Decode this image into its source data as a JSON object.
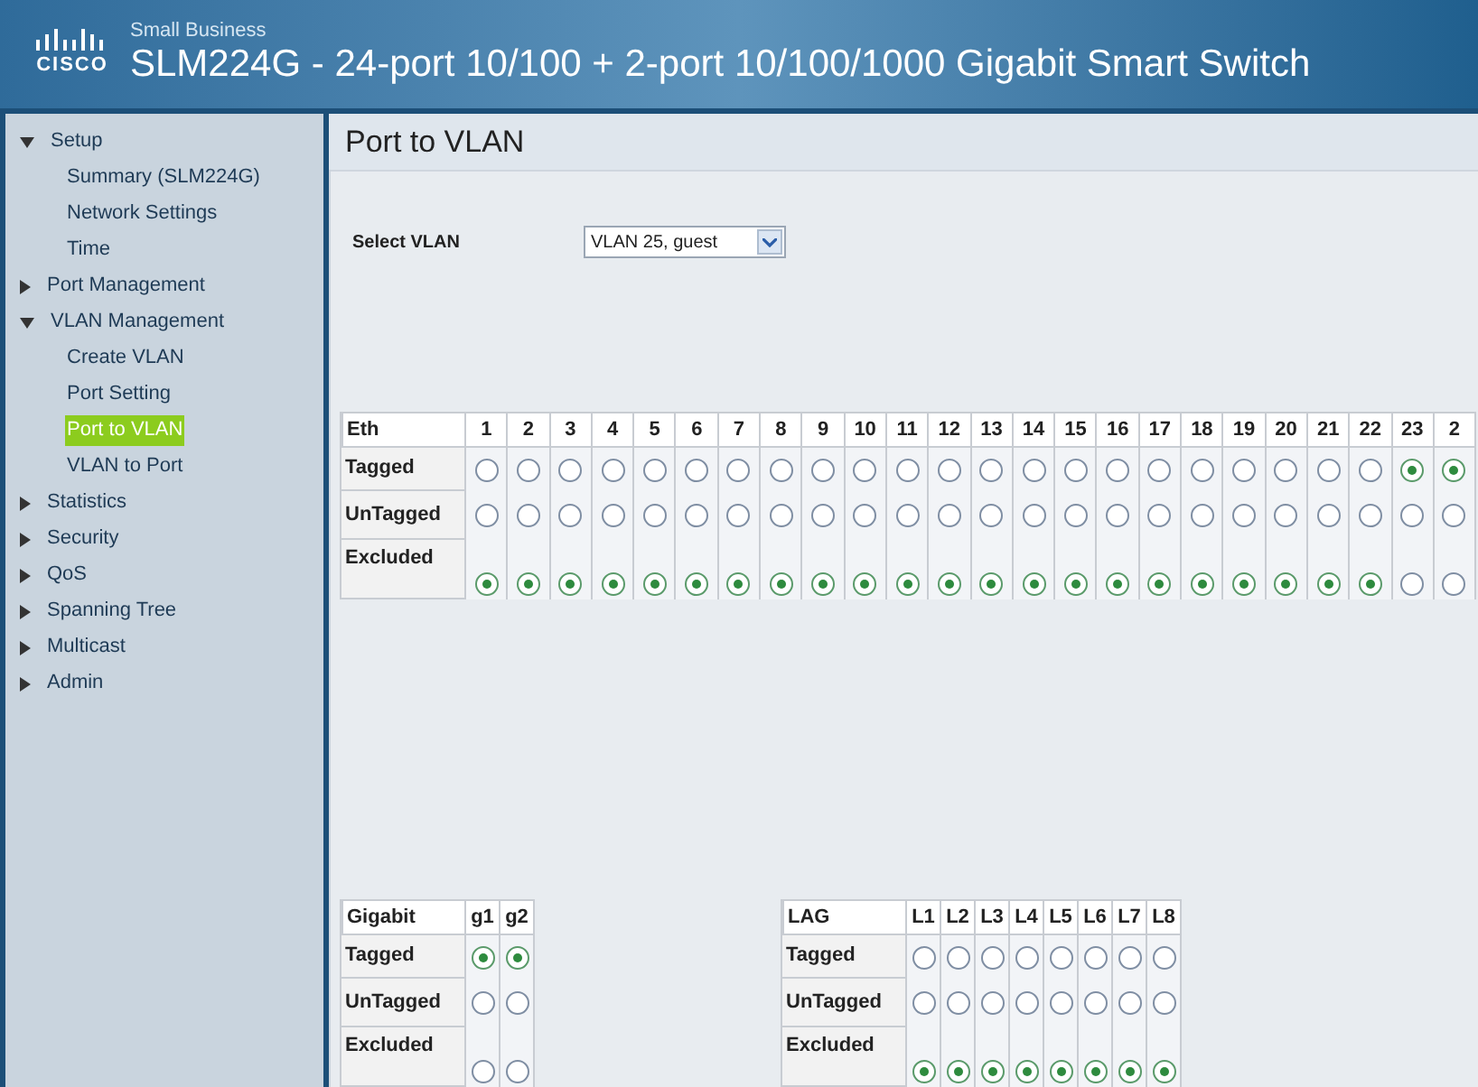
{
  "header": {
    "brand": "CISCO",
    "subtitle": "Small Business",
    "title": "SLM224G - 24-port 10/100 + 2-port 10/100/1000 Gigabit Smart Switch"
  },
  "sidebar": {
    "items": [
      {
        "label": "Setup",
        "expanded": true,
        "selected": false,
        "children": [
          {
            "label": "Summary (SLM224G)",
            "selected": false
          },
          {
            "label": "Network Settings",
            "selected": false
          },
          {
            "label": "Time",
            "selected": false
          }
        ]
      },
      {
        "label": "Port Management",
        "expanded": false,
        "selected": false
      },
      {
        "label": "VLAN Management",
        "expanded": true,
        "selected": false,
        "children": [
          {
            "label": "Create VLAN",
            "selected": false
          },
          {
            "label": "Port Setting",
            "selected": false
          },
          {
            "label": "Port to VLAN",
            "selected": true
          },
          {
            "label": "VLAN to Port",
            "selected": false
          }
        ]
      },
      {
        "label": "Statistics",
        "expanded": false,
        "selected": false
      },
      {
        "label": "Security",
        "expanded": false,
        "selected": false
      },
      {
        "label": "QoS",
        "expanded": false,
        "selected": false
      },
      {
        "label": "Spanning Tree",
        "expanded": false,
        "selected": false
      },
      {
        "label": "Multicast",
        "expanded": false,
        "selected": false
      },
      {
        "label": "Admin",
        "expanded": false,
        "selected": false
      }
    ]
  },
  "page": {
    "title": "Port to VLAN",
    "select_label": "Select VLAN",
    "select_value": "VLAN 25, guest"
  },
  "eth_table": {
    "heading": "Eth",
    "row_labels": [
      "Tagged",
      "UnTagged",
      "Excluded"
    ],
    "ports": [
      {
        "label": "1",
        "modes": [
          {
            "selected": false
          },
          {
            "selected": false
          },
          {
            "selected": true
          }
        ]
      },
      {
        "label": "2",
        "modes": [
          {
            "selected": false
          },
          {
            "selected": false
          },
          {
            "selected": true
          }
        ]
      },
      {
        "label": "3",
        "modes": [
          {
            "selected": false
          },
          {
            "selected": false
          },
          {
            "selected": true
          }
        ]
      },
      {
        "label": "4",
        "modes": [
          {
            "selected": false
          },
          {
            "selected": false
          },
          {
            "selected": true
          }
        ]
      },
      {
        "label": "5",
        "modes": [
          {
            "selected": false
          },
          {
            "selected": false
          },
          {
            "selected": true
          }
        ]
      },
      {
        "label": "6",
        "modes": [
          {
            "selected": false
          },
          {
            "selected": false
          },
          {
            "selected": true
          }
        ]
      },
      {
        "label": "7",
        "modes": [
          {
            "selected": false
          },
          {
            "selected": false
          },
          {
            "selected": true
          }
        ]
      },
      {
        "label": "8",
        "modes": [
          {
            "selected": false
          },
          {
            "selected": false
          },
          {
            "selected": true
          }
        ]
      },
      {
        "label": "9",
        "modes": [
          {
            "selected": false
          },
          {
            "selected": false
          },
          {
            "selected": true
          }
        ]
      },
      {
        "label": "10",
        "modes": [
          {
            "selected": false
          },
          {
            "selected": false
          },
          {
            "selected": true
          }
        ]
      },
      {
        "label": "11",
        "modes": [
          {
            "selected": false
          },
          {
            "selected": false
          },
          {
            "selected": true
          }
        ]
      },
      {
        "label": "12",
        "modes": [
          {
            "selected": false
          },
          {
            "selected": false
          },
          {
            "selected": true
          }
        ]
      },
      {
        "label": "13",
        "modes": [
          {
            "selected": false
          },
          {
            "selected": false
          },
          {
            "selected": true
          }
        ]
      },
      {
        "label": "14",
        "modes": [
          {
            "selected": false
          },
          {
            "selected": false
          },
          {
            "selected": true
          }
        ]
      },
      {
        "label": "15",
        "modes": [
          {
            "selected": false
          },
          {
            "selected": false
          },
          {
            "selected": true
          }
        ]
      },
      {
        "label": "16",
        "modes": [
          {
            "selected": false
          },
          {
            "selected": false
          },
          {
            "selected": true
          }
        ]
      },
      {
        "label": "17",
        "modes": [
          {
            "selected": false
          },
          {
            "selected": false
          },
          {
            "selected": true
          }
        ]
      },
      {
        "label": "18",
        "modes": [
          {
            "selected": false
          },
          {
            "selected": false
          },
          {
            "selected": true
          }
        ]
      },
      {
        "label": "19",
        "modes": [
          {
            "selected": false
          },
          {
            "selected": false
          },
          {
            "selected": true
          }
        ]
      },
      {
        "label": "20",
        "modes": [
          {
            "selected": false
          },
          {
            "selected": false
          },
          {
            "selected": true
          }
        ]
      },
      {
        "label": "21",
        "modes": [
          {
            "selected": false
          },
          {
            "selected": false
          },
          {
            "selected": true
          }
        ]
      },
      {
        "label": "22",
        "modes": [
          {
            "selected": false
          },
          {
            "selected": false
          },
          {
            "selected": true
          }
        ]
      },
      {
        "label": "23",
        "modes": [
          {
            "selected": true
          },
          {
            "selected": false
          },
          {
            "selected": false
          }
        ]
      },
      {
        "label": "2",
        "modes": [
          {
            "selected": true
          },
          {
            "selected": false
          },
          {
            "selected": false
          }
        ]
      }
    ]
  },
  "gigabit_table": {
    "heading": "Gigabit",
    "row_labels": [
      "Tagged",
      "UnTagged",
      "Excluded"
    ],
    "ports": [
      {
        "label": "g1",
        "modes": [
          {
            "selected": true
          },
          {
            "selected": false
          },
          {
            "selected": false
          }
        ]
      },
      {
        "label": "g2",
        "modes": [
          {
            "selected": true
          },
          {
            "selected": false
          },
          {
            "selected": false
          }
        ]
      }
    ]
  },
  "lag_table": {
    "heading": "LAG",
    "row_labels": [
      "Tagged",
      "UnTagged",
      "Excluded"
    ],
    "ports": [
      {
        "label": "L1",
        "modes": [
          {
            "selected": false
          },
          {
            "selected": false
          },
          {
            "selected": true
          }
        ]
      },
      {
        "label": "L2",
        "modes": [
          {
            "selected": false
          },
          {
            "selected": false
          },
          {
            "selected": true
          }
        ]
      },
      {
        "label": "L3",
        "modes": [
          {
            "selected": false
          },
          {
            "selected": false
          },
          {
            "selected": true
          }
        ]
      },
      {
        "label": "L4",
        "modes": [
          {
            "selected": false
          },
          {
            "selected": false
          },
          {
            "selected": true
          }
        ]
      },
      {
        "label": "L5",
        "modes": [
          {
            "selected": false
          },
          {
            "selected": false
          },
          {
            "selected": true
          }
        ]
      },
      {
        "label": "L6",
        "modes": [
          {
            "selected": false
          },
          {
            "selected": false
          },
          {
            "selected": true
          }
        ]
      },
      {
        "label": "L7",
        "modes": [
          {
            "selected": false
          },
          {
            "selected": false
          },
          {
            "selected": true
          }
        ]
      },
      {
        "label": "L8",
        "modes": [
          {
            "selected": false
          },
          {
            "selected": false
          },
          {
            "selected": true
          }
        ]
      }
    ]
  }
}
